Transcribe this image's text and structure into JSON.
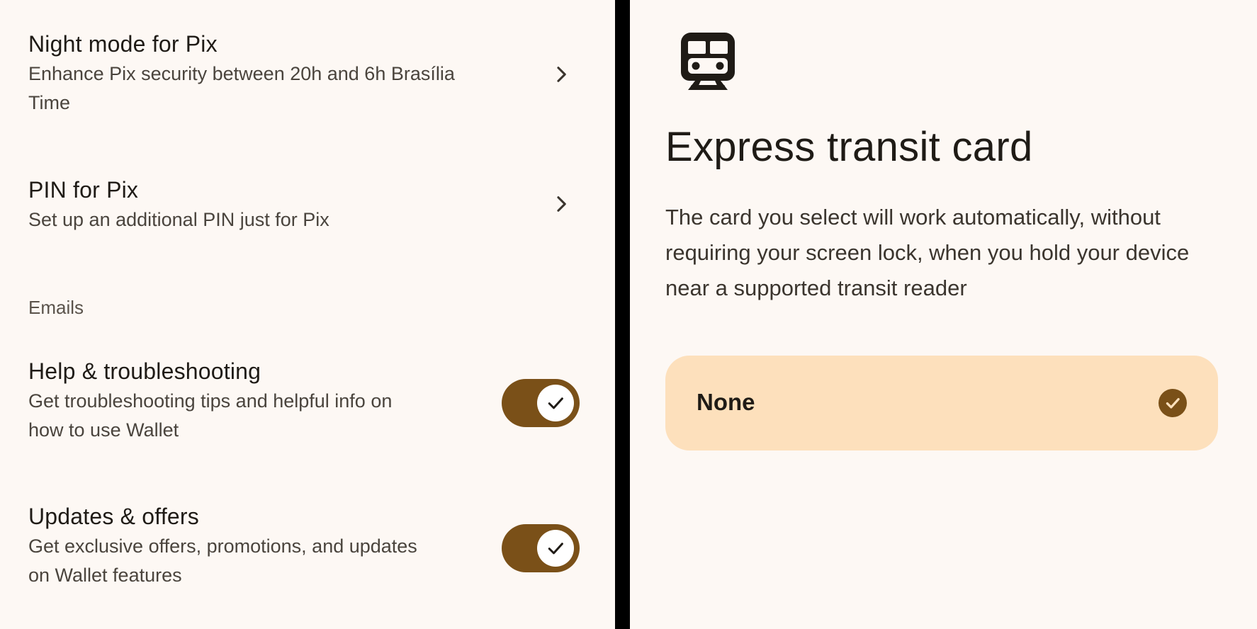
{
  "left_panel": {
    "rows": [
      {
        "title": "Night mode for Pix",
        "subtitle_lines": [
          "Enhance Pix security between 20h and 6h Brasília",
          "Time"
        ]
      },
      {
        "title": "PIN for Pix",
        "subtitle_lines": [
          "Set up an additional PIN just for Pix"
        ]
      }
    ],
    "emails_section": {
      "header": "Emails",
      "toggles": [
        {
          "title": "Help & troubleshooting",
          "subtitle_lines": [
            "Get troubleshooting tips and helpful info on",
            "how to use Wallet"
          ],
          "enabled": true
        },
        {
          "title": "Updates & offers",
          "subtitle_lines": [
            "Get exclusive offers, promotions, and updates",
            "on Wallet features"
          ],
          "enabled": true
        }
      ]
    }
  },
  "right_panel": {
    "icon": "train-icon",
    "title": "Express transit card",
    "description": "The card you select will work automatically, without requiring your screen lock, when you hold your device near a supported transit reader",
    "options": [
      {
        "label": "None",
        "selected": true
      }
    ]
  },
  "colors": {
    "background": "#fdf8f4",
    "accent": "#7a5018",
    "selected_card": "#fde0bc",
    "divider": "#000000"
  }
}
